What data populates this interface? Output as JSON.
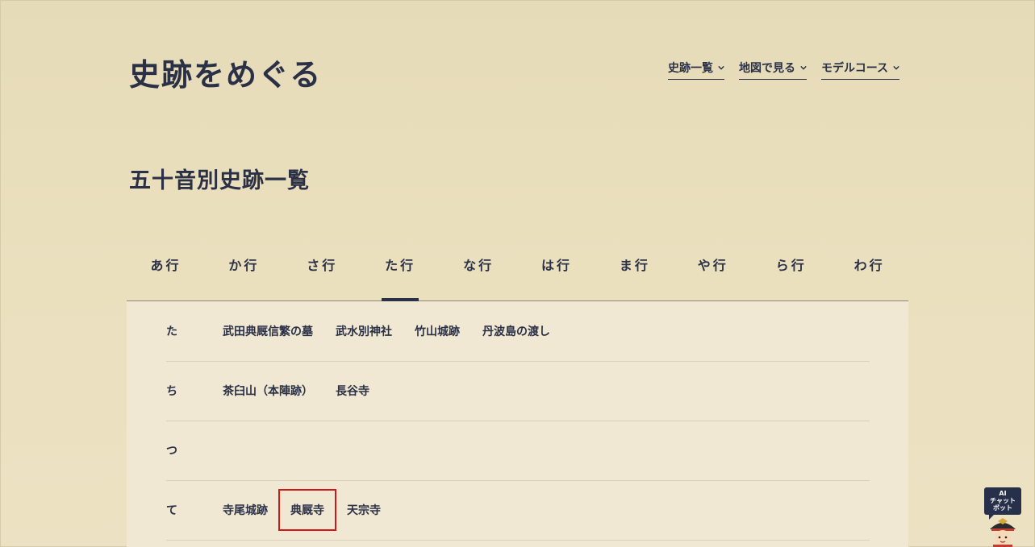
{
  "header": {
    "site_title": "史跡をめぐる",
    "nav": [
      {
        "label": "史跡一覧"
      },
      {
        "label": "地図で見る"
      },
      {
        "label": "モデルコース"
      }
    ]
  },
  "main": {
    "section_title": "五十音別史跡一覧",
    "tabs": [
      {
        "label": "あ行"
      },
      {
        "label": "か行"
      },
      {
        "label": "さ行"
      },
      {
        "label": "た行"
      },
      {
        "label": "な行"
      },
      {
        "label": "は行"
      },
      {
        "label": "ま行"
      },
      {
        "label": "や行"
      },
      {
        "label": "ら行"
      },
      {
        "label": "わ行"
      }
    ],
    "active_tab": "た行",
    "rows": [
      {
        "kana": "た",
        "sites": [
          "武田典厩信繁の墓",
          "武水別神社",
          "竹山城跡",
          "丹波島の渡し"
        ]
      },
      {
        "kana": "ち",
        "sites": [
          "茶臼山（本陣跡）",
          "長谷寺"
        ]
      },
      {
        "kana": "つ",
        "sites": []
      },
      {
        "kana": "て",
        "sites": [
          "寺尾城跡",
          "典厩寺",
          "天宗寺"
        ]
      }
    ]
  },
  "chatbot": {
    "line1": "AI",
    "line2": "チャット",
    "line3": "ボット"
  },
  "colors": {
    "text": "#2a3046",
    "background": "#e9dfbe",
    "panel": "#f0e8d2",
    "highlight": "#d01818"
  }
}
